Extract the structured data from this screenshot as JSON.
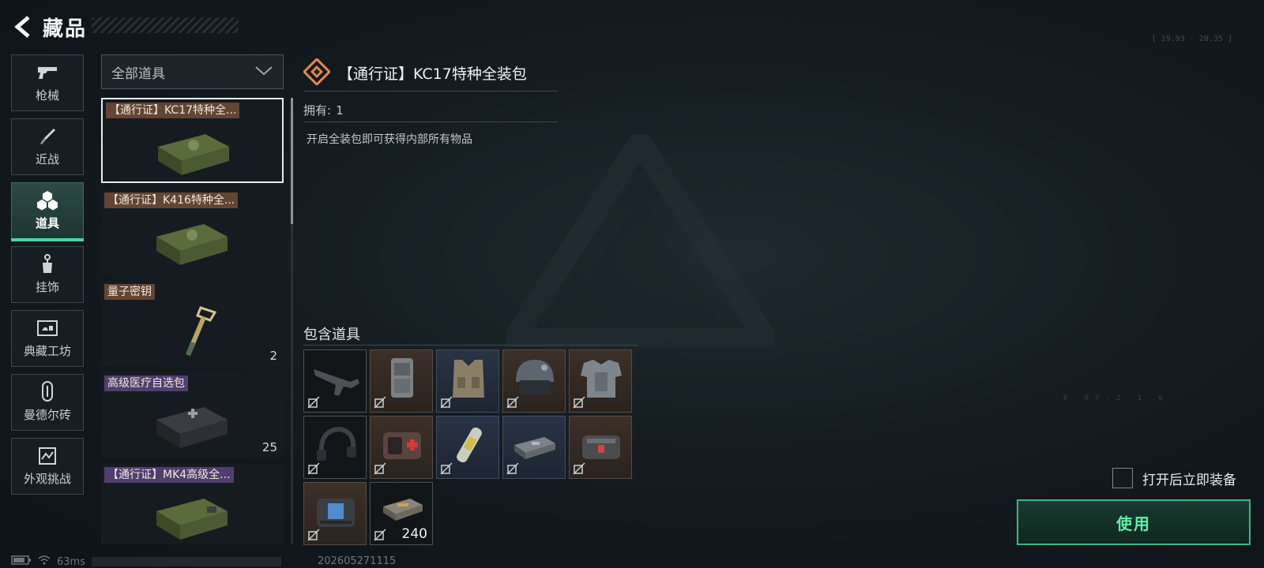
{
  "header": {
    "title": "藏品"
  },
  "sidebar": {
    "items": [
      {
        "label": "枪械",
        "icon": "gun-icon"
      },
      {
        "label": "近战",
        "icon": "knife-icon"
      },
      {
        "label": "道具",
        "icon": "props-icon",
        "active": true
      },
      {
        "label": "挂饰",
        "icon": "charm-icon"
      },
      {
        "label": "典藏工坊",
        "icon": "workshop-icon"
      },
      {
        "label": "曼德尔砖",
        "icon": "brick-icon"
      },
      {
        "label": "外观挑战",
        "icon": "challenge-icon"
      }
    ]
  },
  "filter": {
    "value": "全部道具"
  },
  "items": [
    {
      "name": "【通行证】KC17特种全...",
      "count": "",
      "tag": "brown",
      "selected": true
    },
    {
      "name": "【通行证】K416特种全...",
      "count": "",
      "tag": "brown"
    },
    {
      "name": "量子密钥",
      "count": "2",
      "tag": "brown"
    },
    {
      "name": "高级医疗自选包",
      "count": "25",
      "tag": "purple"
    },
    {
      "name": "【通行证】MK4高级全...",
      "count": "",
      "tag": "purple"
    }
  ],
  "detail": {
    "title": "【通行证】KC17特种全装包",
    "owned_label": "拥有:",
    "owned_value": "1",
    "description": "开启全装包即可获得内部所有物品",
    "contents_label": "包含道具"
  },
  "contents": [
    {
      "icon": "rifle-icon",
      "rarity": "dark",
      "qty": ""
    },
    {
      "icon": "backpack-icon",
      "rarity": "gold",
      "qty": ""
    },
    {
      "icon": "chest-rig-icon",
      "rarity": "blue",
      "qty": ""
    },
    {
      "icon": "helmet-icon",
      "rarity": "gold",
      "qty": ""
    },
    {
      "icon": "body-armor-icon",
      "rarity": "gold",
      "qty": ""
    },
    {
      "icon": "headset-icon",
      "rarity": "dark",
      "qty": ""
    },
    {
      "icon": "medkit-icon",
      "rarity": "gold",
      "qty": ""
    },
    {
      "icon": "injector-icon",
      "rarity": "blue",
      "qty": ""
    },
    {
      "icon": "bandage-icon",
      "rarity": "blue",
      "qty": ""
    },
    {
      "icon": "med-pouch-icon",
      "rarity": "gold",
      "qty": ""
    },
    {
      "icon": "device-pouch-icon",
      "rarity": "gold",
      "qty": ""
    },
    {
      "icon": "ammo-box-icon",
      "rarity": "dark",
      "qty": "240"
    }
  ],
  "actions": {
    "equip_label": "打开后立即装备",
    "use_label": "使用"
  },
  "status": {
    "ping": "63ms",
    "version": "202605271115"
  },
  "colors": {
    "accent": "#4ed3a0",
    "gold_rarity": "#3c3028",
    "blue_rarity": "#283344"
  }
}
